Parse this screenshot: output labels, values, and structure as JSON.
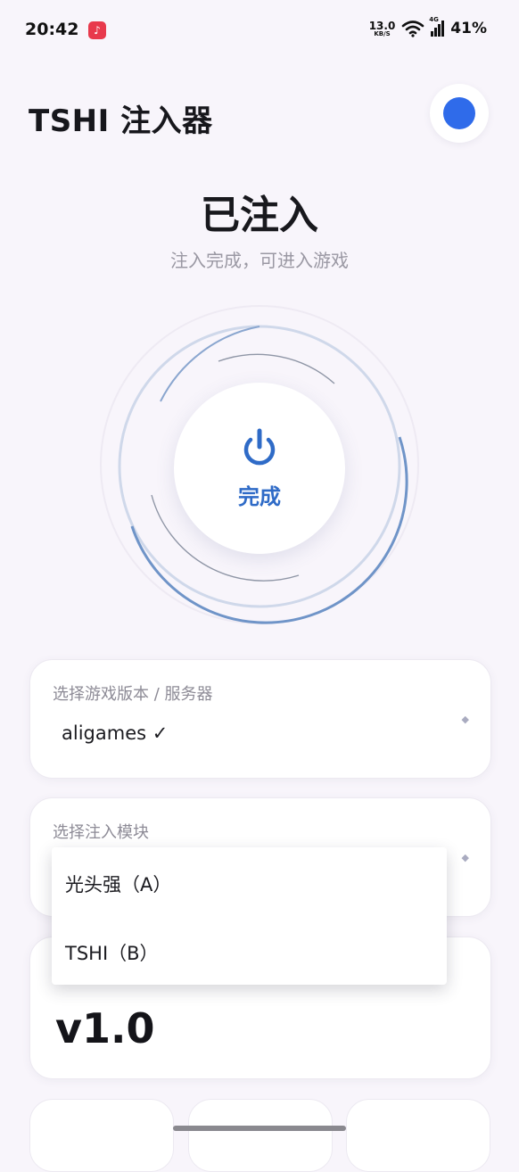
{
  "status_bar": {
    "time": "20:42",
    "notification_icon": "music-app-icon",
    "net_speed_value": "13.0",
    "net_speed_unit": "KB/S",
    "network_type": "4G",
    "battery": "41%"
  },
  "header": {
    "title": "TSHI 注入器",
    "avatar_color": "#2f6bea"
  },
  "status": {
    "title": "已注入",
    "subtitle": "注入完成，可进入游戏"
  },
  "inject_button": {
    "label": "完成",
    "icon": "power-icon",
    "accent_color": "#2f6bc7"
  },
  "server_select": {
    "label": "选择游戏版本 / 服务器",
    "value": "aligames ✓"
  },
  "module_select": {
    "label": "选择注入模块",
    "options": [
      "光头强（A）",
      "TSHI（B）"
    ]
  },
  "version": {
    "value": "v1.0"
  }
}
